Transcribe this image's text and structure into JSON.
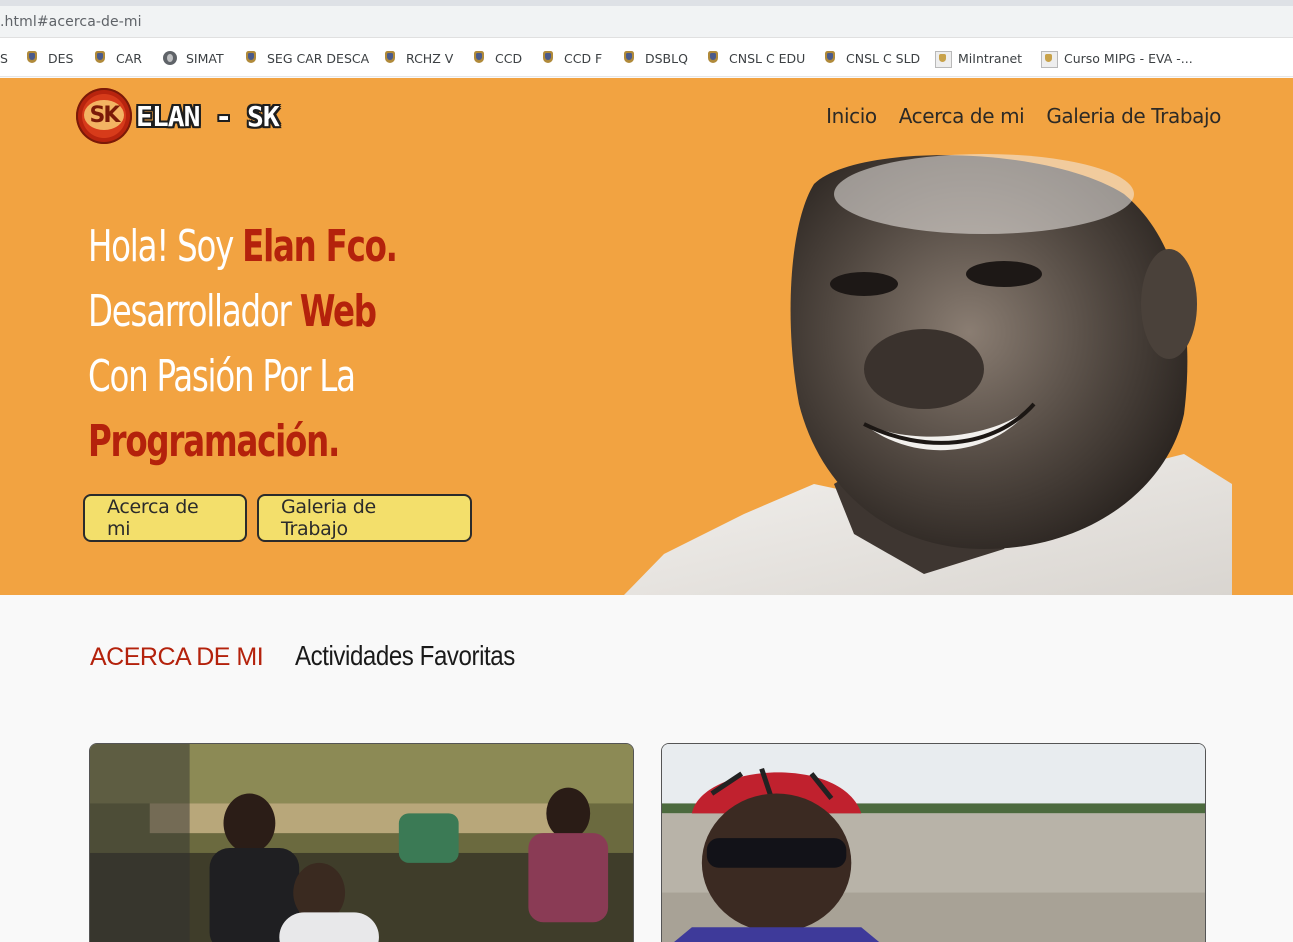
{
  "browser": {
    "url": ".html#acerca-de-mi",
    "bookmarks": [
      {
        "label": "S",
        "icon": "none"
      },
      {
        "label": "DES",
        "icon": "shield-icon"
      },
      {
        "label": "CAR",
        "icon": "shield-icon"
      },
      {
        "label": "SIMAT",
        "icon": "globe-icon"
      },
      {
        "label": "SEG CAR DESCA",
        "icon": "shield-icon"
      },
      {
        "label": "RCHZ V",
        "icon": "shield-icon"
      },
      {
        "label": "CCD",
        "icon": "shield-icon"
      },
      {
        "label": "CCD F",
        "icon": "shield-icon"
      },
      {
        "label": "DSBLQ",
        "icon": "shield-icon"
      },
      {
        "label": "CNSL C EDU",
        "icon": "shield-icon"
      },
      {
        "label": "CNSL C SLD",
        "icon": "shield-icon"
      },
      {
        "label": "MiIntranet",
        "icon": "crest-icon"
      },
      {
        "label": "Curso MIPG - EVA -...",
        "icon": "crest-icon"
      }
    ]
  },
  "site": {
    "logo_text": "ELAN - SK",
    "logo_badge": "SK",
    "nav": [
      "Inicio",
      "Acerca de mi",
      "Galeria de Trabajo"
    ],
    "hero": {
      "line1_a": "Hola! Soy ",
      "line1_b": "Elan Fco.",
      "line2_a": "Desarrollador ",
      "line2_b": "Web",
      "line3": "Con Pasión Por La",
      "line4": "Programación.",
      "btn_about": "Acerca de mi",
      "btn_gallery": "Galeria de Trabajo"
    },
    "section": {
      "tab_active": "ACERCA DE MI",
      "tab_other": "Actividades Favoritas"
    }
  },
  "colors": {
    "hero_bg": "#f2a341",
    "accent_red": "#b4220c",
    "button_bg": "#f3df6b"
  }
}
